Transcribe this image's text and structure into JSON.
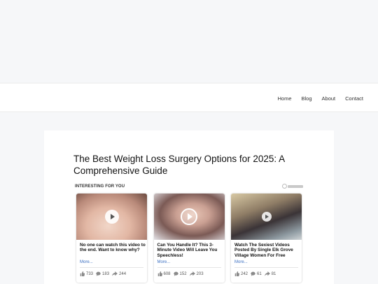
{
  "nav": {
    "links": [
      "Home",
      "Blog",
      "About",
      "Contact"
    ]
  },
  "article": {
    "title": "The Best Weight Loss Surgery Options for 2025: A Comprehensive Guide"
  },
  "widget": {
    "label": "INTERESTING FOR YOU",
    "tiles": [
      {
        "text": "No one can watch this video to the end. Want to know why?",
        "more": "More...",
        "likes": "733",
        "comments": "183",
        "shares": "244"
      },
      {
        "text": "Can You Handle It? This 3-Minute Video Will Leave You Speechless!",
        "more": "More...",
        "likes": "608",
        "comments": "152",
        "shares": "203"
      },
      {
        "text": "Watch The Sexiest Videos Posted By Single Elk Grove Village Women For Free",
        "more": "More...",
        "likes": "242",
        "comments": "61",
        "shares": "81"
      }
    ]
  },
  "colors": {
    "page_bg": "#f6f7f9",
    "link_blue": "#3b6fc1"
  }
}
